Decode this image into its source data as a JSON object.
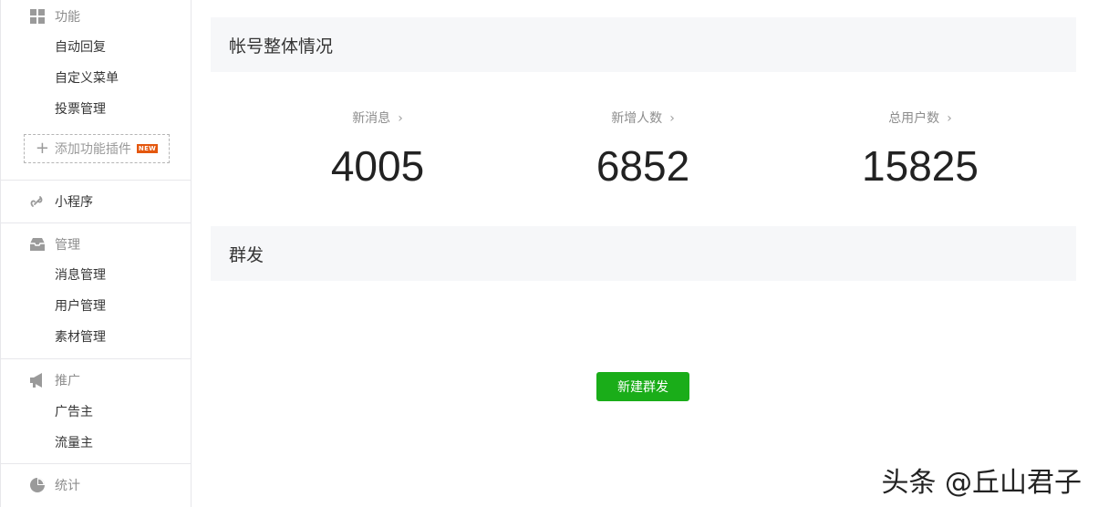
{
  "sidebar": {
    "functions": {
      "icon": "grid-icon",
      "title": "功能",
      "items": [
        "自动回复",
        "自定义菜单",
        "投票管理"
      ],
      "plugin_label": "添加功能插件",
      "new_badge": "NEW"
    },
    "miniprogram": {
      "icon": "link-icon",
      "title": "小程序"
    },
    "manage": {
      "icon": "inbox-icon",
      "title": "管理",
      "items": [
        "消息管理",
        "用户管理",
        "素材管理"
      ]
    },
    "promote": {
      "icon": "megaphone-icon",
      "title": "推广",
      "items": [
        "广告主",
        "流量主"
      ]
    },
    "stats": {
      "icon": "pie-icon",
      "title": "统计"
    }
  },
  "overview": {
    "title": "帐号整体情况",
    "stats": [
      {
        "label": "新消息",
        "value": "4005"
      },
      {
        "label": "新增人数",
        "value": "6852"
      },
      {
        "label": "总用户数",
        "value": "15825"
      }
    ]
  },
  "mass": {
    "title": "群发",
    "new_button": "新建群发"
  },
  "watermark": "头条 @丘山君子",
  "colors": {
    "accent_green": "#1aad19",
    "badge_orange": "#e4570e",
    "panel_bg": "#f6f7f9"
  }
}
